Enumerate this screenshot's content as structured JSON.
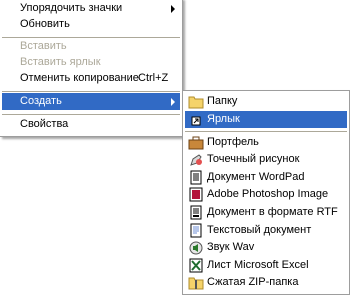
{
  "context_menu": {
    "items": [
      {
        "label": "Упорядочить значки",
        "enabled": true,
        "submenu": true
      },
      {
        "label": "Обновить",
        "enabled": true
      },
      {
        "label": "Вставить",
        "enabled": false
      },
      {
        "label": "Вставить ярлык",
        "enabled": false
      },
      {
        "label": "Отменить копирование",
        "shortcut": "Ctrl+Z",
        "enabled": true
      },
      {
        "label": "Создать",
        "enabled": true,
        "submenu": true,
        "highlighted": true
      },
      {
        "label": "Свойства",
        "enabled": true
      }
    ]
  },
  "create_submenu": {
    "items": [
      {
        "label": "Папку",
        "icon": "folder-icon"
      },
      {
        "label": "Ярлык",
        "icon": "shortcut-icon",
        "highlighted": true
      },
      {
        "label": "Портфель",
        "icon": "briefcase-icon"
      },
      {
        "label": "Точечный рисунок",
        "icon": "bitmap-icon"
      },
      {
        "label": "Документ WordPad",
        "icon": "wordpad-icon"
      },
      {
        "label": "Adobe Photoshop Image",
        "icon": "photoshop-icon"
      },
      {
        "label": "Документ в формате RTF",
        "icon": "rtf-icon"
      },
      {
        "label": "Текстовый документ",
        "icon": "text-document-icon"
      },
      {
        "label": "Звук Wav",
        "icon": "sound-icon"
      },
      {
        "label": "Лист Microsoft Excel",
        "icon": "excel-icon"
      },
      {
        "label": "Сжатая ZIP-папка",
        "icon": "zip-folder-icon"
      }
    ]
  },
  "colors": {
    "highlight": "#316ac5",
    "disabled_text": "#aca899",
    "menu_background": "#ffffff"
  }
}
